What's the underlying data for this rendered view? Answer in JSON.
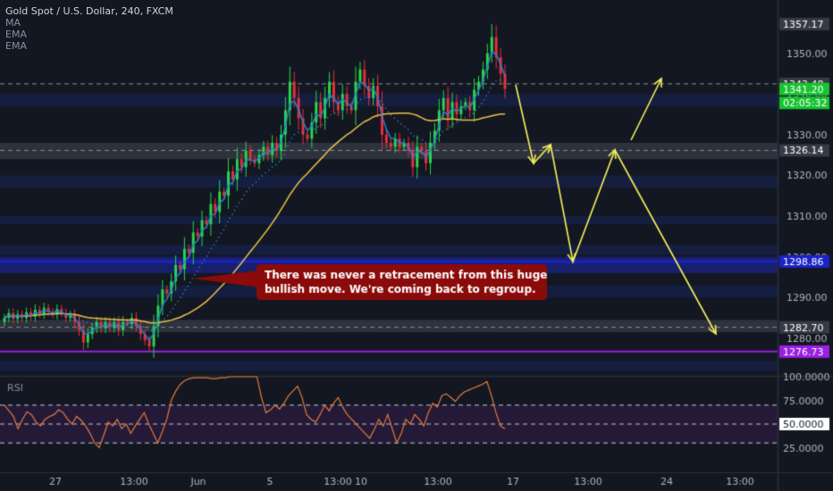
{
  "header": {
    "title": "Gold Spot / U.S. Dollar, 240, FXCM",
    "indicators": [
      "MA",
      "EMA",
      "EMA"
    ]
  },
  "annotation": {
    "text_line1": "There was never a retracement from this huge",
    "text_line2": "bullish move. We're coming back to regroup."
  },
  "colors": {
    "background": "#131722",
    "bull": "#26d94a",
    "bear": "#e8303a",
    "ma_slow": "#e8c24a",
    "ema_fast": "#2b80c8",
    "ema_dotted": "#3aa0e8",
    "projection": "#f5f05a",
    "callout": "#8b0a0a",
    "support_blue": "#1a22c8",
    "purple": "#9b1fe0",
    "rsi": "#e07b39",
    "axis_text": "#b2b5be"
  },
  "chart_data": [
    {
      "type": "candlestick",
      "symbol": "Gold Spot / U.S. Dollar",
      "timeframe": "240",
      "y_axis": {
        "range": [
          1271,
          1360
        ],
        "ticks": [
          1280,
          1290,
          1300,
          1310,
          1320,
          1330,
          1340,
          1350
        ]
      },
      "x_axis": {
        "ticks": [
          "27",
          "13:00",
          "Jun",
          "5",
          "13:00",
          "10",
          "13:00",
          "17",
          "13:00",
          "24",
          "13:00"
        ]
      },
      "price_labels": [
        {
          "value": 1357.17,
          "label": "1357.17",
          "style": "dark"
        },
        {
          "value": 1342.48,
          "label": "1342.48",
          "style": "dark"
        },
        {
          "value": 1341.2,
          "label": "1341.20",
          "style": "green"
        },
        {
          "value": 1337.8,
          "label": "02:05:32",
          "style": "green"
        },
        {
          "value": 1326.14,
          "label": "1326.14",
          "style": "dark"
        },
        {
          "value": 1298.86,
          "label": "1298.86",
          "style": "blue"
        },
        {
          "value": 1282.7,
          "label": "1282.70",
          "style": "dark"
        },
        {
          "value": 1276.73,
          "label": "1276.73",
          "style": "purple"
        }
      ],
      "horizontal_levels": [
        {
          "value": 1342.48,
          "style": "dashed"
        },
        {
          "value": 1326.14,
          "style": "dashed"
        },
        {
          "value": 1282.7,
          "style": "dashed"
        },
        {
          "value": 1298.86,
          "style": "blue-thick"
        },
        {
          "value": 1276.73,
          "style": "purple"
        }
      ],
      "zones": [
        {
          "from": 1337,
          "to": 1340,
          "style": "blue"
        },
        {
          "from": 1324,
          "to": 1328,
          "style": "gray"
        },
        {
          "from": 1317,
          "to": 1320,
          "style": "blue"
        },
        {
          "from": 1308,
          "to": 1310,
          "style": "blue"
        },
        {
          "from": 1300.5,
          "to": 1303,
          "style": "blue"
        },
        {
          "from": 1296,
          "to": 1300,
          "style": "blue-strong"
        },
        {
          "from": 1290,
          "to": 1293,
          "style": "blue"
        },
        {
          "from": 1281.5,
          "to": 1284.5,
          "style": "gray"
        },
        {
          "from": 1272,
          "to": 1274.5,
          "style": "blue"
        }
      ],
      "closes": [
        1285,
        1286.2,
        1284.8,
        1285.9,
        1285,
        1286.4,
        1285.3,
        1287,
        1286,
        1287.5,
        1286.5,
        1285.8,
        1287.2,
        1286.2,
        1285,
        1285.8,
        1284,
        1282,
        1279,
        1281,
        1282.5,
        1284,
        1282.5,
        1284,
        1282.6,
        1284,
        1282,
        1284,
        1283.5,
        1285,
        1283,
        1281,
        1279.5,
        1278,
        1283,
        1288,
        1292,
        1291,
        1294,
        1298,
        1297,
        1302,
        1301,
        1306,
        1305,
        1309,
        1308,
        1313,
        1311,
        1316,
        1315,
        1321,
        1319,
        1324,
        1322,
        1326,
        1324,
        1323,
        1325,
        1327,
        1325,
        1328,
        1326,
        1330,
        1336,
        1343,
        1339,
        1334,
        1330,
        1329,
        1333,
        1338,
        1334,
        1339,
        1343,
        1338,
        1336,
        1340,
        1337,
        1336,
        1343,
        1346,
        1342,
        1339,
        1342,
        1337,
        1330,
        1328,
        1327,
        1329,
        1327,
        1328,
        1326,
        1322,
        1327,
        1326,
        1323,
        1328,
        1331,
        1336,
        1339,
        1334,
        1338,
        1335,
        1337,
        1338,
        1336,
        1341,
        1343,
        1346,
        1350,
        1354,
        1349,
        1345,
        1341.2
      ],
      "highs_max": 1357.17,
      "lows_min": 1276.73,
      "projection_path": [
        [
          577,
          95
        ],
        [
          597,
          183
        ],
        [
          616,
          162
        ],
        [
          641,
          293
        ],
        [
          688,
          168
        ],
        [
          801,
          374
        ]
      ],
      "projection_arrow_second": [
        [
          706,
          157
        ],
        [
          740,
          88
        ]
      ],
      "rsi": {
        "y_ticks": [
          "100.0000",
          "75.0000",
          "50.0000",
          "25.0000"
        ],
        "levels": [
          70,
          50,
          30
        ],
        "current_label": "50.0000",
        "label": "RSI",
        "values": [
          70,
          64,
          58,
          45,
          55,
          63,
          60,
          52,
          48,
          55,
          58,
          60,
          65,
          62,
          55,
          50,
          58,
          54,
          48,
          40,
          30,
          25,
          38,
          52,
          48,
          55,
          45,
          50,
          40,
          48,
          55,
          62,
          50,
          40,
          30,
          42,
          55,
          75,
          85,
          92,
          96,
          98,
          99,
          99,
          99,
          99,
          98,
          98,
          99,
          99,
          100,
          100,
          100,
          100,
          100,
          100,
          100,
          78,
          62,
          65,
          70,
          66,
          72,
          80,
          85,
          90,
          78,
          60,
          55,
          52,
          60,
          70,
          64,
          72,
          78,
          68,
          60,
          55,
          50,
          45,
          40,
          35,
          44,
          55,
          48,
          60,
          45,
          30,
          40,
          55,
          50,
          60,
          55,
          48,
          62,
          72,
          68,
          80,
          82,
          78,
          74,
          80,
          84,
          86,
          88,
          90,
          92,
          95,
          80,
          62,
          48,
          45
        ]
      }
    }
  ]
}
